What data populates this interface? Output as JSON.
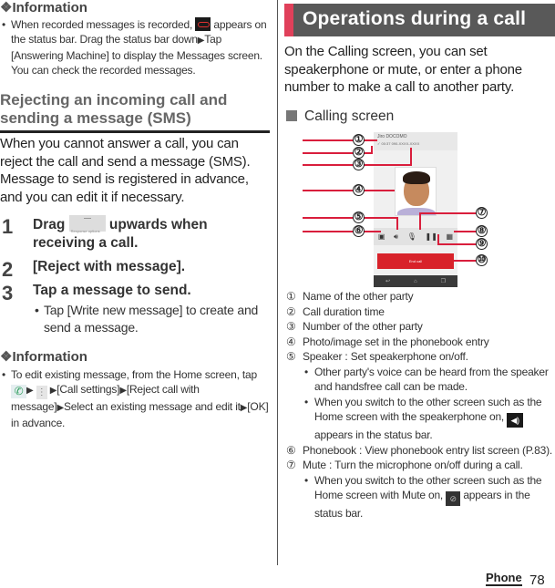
{
  "left": {
    "info1": {
      "heading": "Information",
      "diamond": "❖",
      "bullet_parts": [
        "When recorded messages is recorded, ",
        " appears on the status bar. Drag the status bar down",
        "Tap [Answering Machine] to display the Messages screen. You can check the recorded messages."
      ],
      "icon": "voicemail-icon"
    },
    "section": {
      "title": "Rejecting an incoming call and sending a message (SMS)",
      "intro": "When you cannot answer a call, you can reject the call and send a message (SMS). Message to send is registered in advance, and you can edit it if necessary."
    },
    "steps": [
      {
        "num": "1",
        "text_before": "Drag ",
        "chip_label": "Response options",
        "text_after": " upwards when receiving a call."
      },
      {
        "num": "2",
        "text": "[Reject with message]."
      },
      {
        "num": "3",
        "text": "Tap a message to send.",
        "bullet": "Tap [Write new message] to create and send a message."
      }
    ],
    "info2": {
      "heading": "Information",
      "diamond": "❖",
      "bullet_parts": [
        "To edit existing message, from the Home screen, tap ",
        "[Call settings]",
        "[Reject call with message]",
        "Select an existing message and edit it",
        "[OK] in advance."
      ]
    }
  },
  "right": {
    "banner": "Operations during a call",
    "intro": "On the Calling screen, you can set speakerphone or mute, or enter a phone number to make a call to another party.",
    "subheading": "Calling screen",
    "figure": {
      "name": "Jiro DOCOMO",
      "status": "✓ 00:37   090-XXXX-XXXX",
      "end_call": "End call",
      "callouts": [
        "①",
        "②",
        "③",
        "④",
        "⑤",
        "⑥",
        "⑦",
        "⑧",
        "⑨",
        "⑩"
      ]
    },
    "legend": [
      {
        "num": "①",
        "text": "Name of the other party"
      },
      {
        "num": "②",
        "text": "Call duration time"
      },
      {
        "num": "③",
        "text": "Number of the other party"
      },
      {
        "num": "④",
        "text": "Photo/image set in the phonebook entry"
      },
      {
        "num": "⑤",
        "text": "Speaker : Set speakerphone on/off.",
        "subs": [
          "Other party's voice can be heard from the speaker and handsfree call can be made."
        ],
        "sub2_parts": [
          "When you switch to the other screen such as the Home screen with the speakerphone on, ",
          " appears in the status bar."
        ]
      },
      {
        "num": "⑥",
        "text": "Phonebook : View phonebook entry list screen (P.83)."
      },
      {
        "num": "⑦",
        "text": "Mute : Turn the microphone on/off during a call.",
        "sub2_parts": [
          "When you switch to the other screen such as the Home screen with Mute on, ",
          " appears in the status bar."
        ]
      }
    ]
  },
  "footer": {
    "section": "Phone",
    "page": "78"
  },
  "arrow": "▶",
  "colors": {
    "accent": "#e0405a",
    "banner": "#595959",
    "leader": "#d91e3c",
    "end_call": "#d8222a"
  }
}
